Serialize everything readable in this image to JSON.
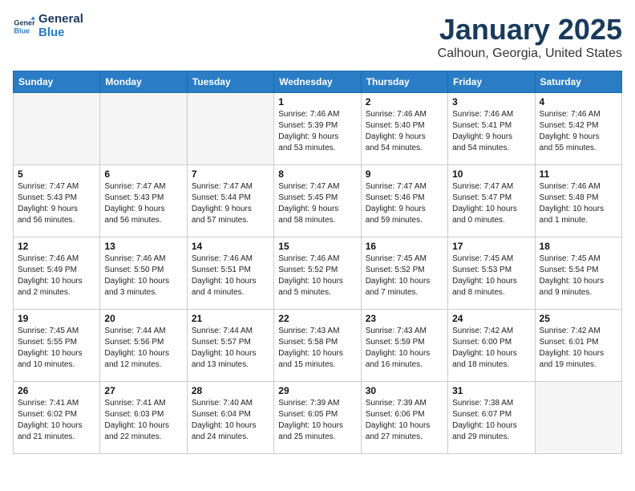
{
  "header": {
    "logo_line1": "General",
    "logo_line2": "Blue",
    "month": "January 2025",
    "location": "Calhoun, Georgia, United States"
  },
  "weekdays": [
    "Sunday",
    "Monday",
    "Tuesday",
    "Wednesday",
    "Thursday",
    "Friday",
    "Saturday"
  ],
  "weeks": [
    [
      {
        "day": "",
        "info": ""
      },
      {
        "day": "",
        "info": ""
      },
      {
        "day": "",
        "info": ""
      },
      {
        "day": "1",
        "info": "Sunrise: 7:46 AM\nSunset: 5:39 PM\nDaylight: 9 hours\nand 53 minutes."
      },
      {
        "day": "2",
        "info": "Sunrise: 7:46 AM\nSunset: 5:40 PM\nDaylight: 9 hours\nand 54 minutes."
      },
      {
        "day": "3",
        "info": "Sunrise: 7:46 AM\nSunset: 5:41 PM\nDaylight: 9 hours\nand 54 minutes."
      },
      {
        "day": "4",
        "info": "Sunrise: 7:46 AM\nSunset: 5:42 PM\nDaylight: 9 hours\nand 55 minutes."
      }
    ],
    [
      {
        "day": "5",
        "info": "Sunrise: 7:47 AM\nSunset: 5:43 PM\nDaylight: 9 hours\nand 56 minutes."
      },
      {
        "day": "6",
        "info": "Sunrise: 7:47 AM\nSunset: 5:43 PM\nDaylight: 9 hours\nand 56 minutes."
      },
      {
        "day": "7",
        "info": "Sunrise: 7:47 AM\nSunset: 5:44 PM\nDaylight: 9 hours\nand 57 minutes."
      },
      {
        "day": "8",
        "info": "Sunrise: 7:47 AM\nSunset: 5:45 PM\nDaylight: 9 hours\nand 58 minutes."
      },
      {
        "day": "9",
        "info": "Sunrise: 7:47 AM\nSunset: 5:46 PM\nDaylight: 9 hours\nand 59 minutes."
      },
      {
        "day": "10",
        "info": "Sunrise: 7:47 AM\nSunset: 5:47 PM\nDaylight: 10 hours\nand 0 minutes."
      },
      {
        "day": "11",
        "info": "Sunrise: 7:46 AM\nSunset: 5:48 PM\nDaylight: 10 hours\nand 1 minute."
      }
    ],
    [
      {
        "day": "12",
        "info": "Sunrise: 7:46 AM\nSunset: 5:49 PM\nDaylight: 10 hours\nand 2 minutes."
      },
      {
        "day": "13",
        "info": "Sunrise: 7:46 AM\nSunset: 5:50 PM\nDaylight: 10 hours\nand 3 minutes."
      },
      {
        "day": "14",
        "info": "Sunrise: 7:46 AM\nSunset: 5:51 PM\nDaylight: 10 hours\nand 4 minutes."
      },
      {
        "day": "15",
        "info": "Sunrise: 7:46 AM\nSunset: 5:52 PM\nDaylight: 10 hours\nand 5 minutes."
      },
      {
        "day": "16",
        "info": "Sunrise: 7:45 AM\nSunset: 5:52 PM\nDaylight: 10 hours\nand 7 minutes."
      },
      {
        "day": "17",
        "info": "Sunrise: 7:45 AM\nSunset: 5:53 PM\nDaylight: 10 hours\nand 8 minutes."
      },
      {
        "day": "18",
        "info": "Sunrise: 7:45 AM\nSunset: 5:54 PM\nDaylight: 10 hours\nand 9 minutes."
      }
    ],
    [
      {
        "day": "19",
        "info": "Sunrise: 7:45 AM\nSunset: 5:55 PM\nDaylight: 10 hours\nand 10 minutes."
      },
      {
        "day": "20",
        "info": "Sunrise: 7:44 AM\nSunset: 5:56 PM\nDaylight: 10 hours\nand 12 minutes."
      },
      {
        "day": "21",
        "info": "Sunrise: 7:44 AM\nSunset: 5:57 PM\nDaylight: 10 hours\nand 13 minutes."
      },
      {
        "day": "22",
        "info": "Sunrise: 7:43 AM\nSunset: 5:58 PM\nDaylight: 10 hours\nand 15 minutes."
      },
      {
        "day": "23",
        "info": "Sunrise: 7:43 AM\nSunset: 5:59 PM\nDaylight: 10 hours\nand 16 minutes."
      },
      {
        "day": "24",
        "info": "Sunrise: 7:42 AM\nSunset: 6:00 PM\nDaylight: 10 hours\nand 18 minutes."
      },
      {
        "day": "25",
        "info": "Sunrise: 7:42 AM\nSunset: 6:01 PM\nDaylight: 10 hours\nand 19 minutes."
      }
    ],
    [
      {
        "day": "26",
        "info": "Sunrise: 7:41 AM\nSunset: 6:02 PM\nDaylight: 10 hours\nand 21 minutes."
      },
      {
        "day": "27",
        "info": "Sunrise: 7:41 AM\nSunset: 6:03 PM\nDaylight: 10 hours\nand 22 minutes."
      },
      {
        "day": "28",
        "info": "Sunrise: 7:40 AM\nSunset: 6:04 PM\nDaylight: 10 hours\nand 24 minutes."
      },
      {
        "day": "29",
        "info": "Sunrise: 7:39 AM\nSunset: 6:05 PM\nDaylight: 10 hours\nand 25 minutes."
      },
      {
        "day": "30",
        "info": "Sunrise: 7:39 AM\nSunset: 6:06 PM\nDaylight: 10 hours\nand 27 minutes."
      },
      {
        "day": "31",
        "info": "Sunrise: 7:38 AM\nSunset: 6:07 PM\nDaylight: 10 hours\nand 29 minutes."
      },
      {
        "day": "",
        "info": ""
      }
    ]
  ]
}
